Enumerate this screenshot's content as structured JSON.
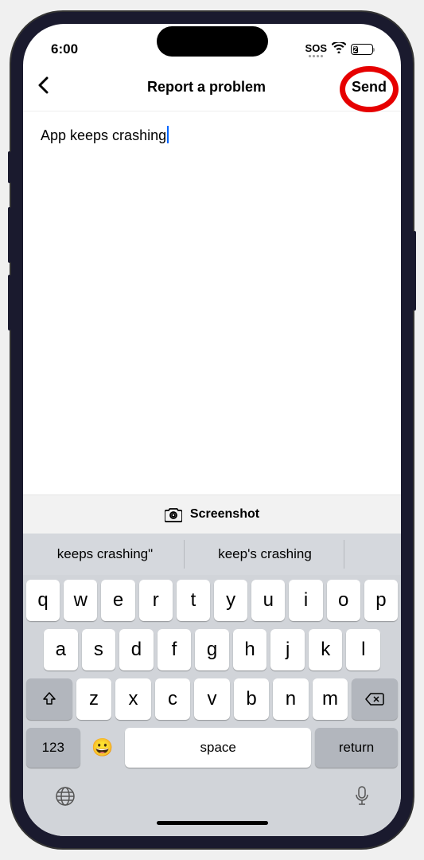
{
  "status_bar": {
    "time": "6:00",
    "sos": "SOS",
    "battery_level": "27"
  },
  "nav": {
    "title": "Report a problem",
    "send": "Send"
  },
  "content": {
    "text": "App keeps crashing"
  },
  "screenshot": {
    "label": "Screenshot"
  },
  "suggestions": {
    "s1": "keeps crashing\"",
    "s2": "keep's crashing",
    "s3": ""
  },
  "keyboard": {
    "row1": [
      "q",
      "w",
      "e",
      "r",
      "t",
      "y",
      "u",
      "i",
      "o",
      "p"
    ],
    "row2": [
      "a",
      "s",
      "d",
      "f",
      "g",
      "h",
      "j",
      "k",
      "l"
    ],
    "row3": [
      "z",
      "x",
      "c",
      "v",
      "b",
      "n",
      "m"
    ],
    "key_123": "123",
    "key_space": "space",
    "key_return": "return"
  }
}
